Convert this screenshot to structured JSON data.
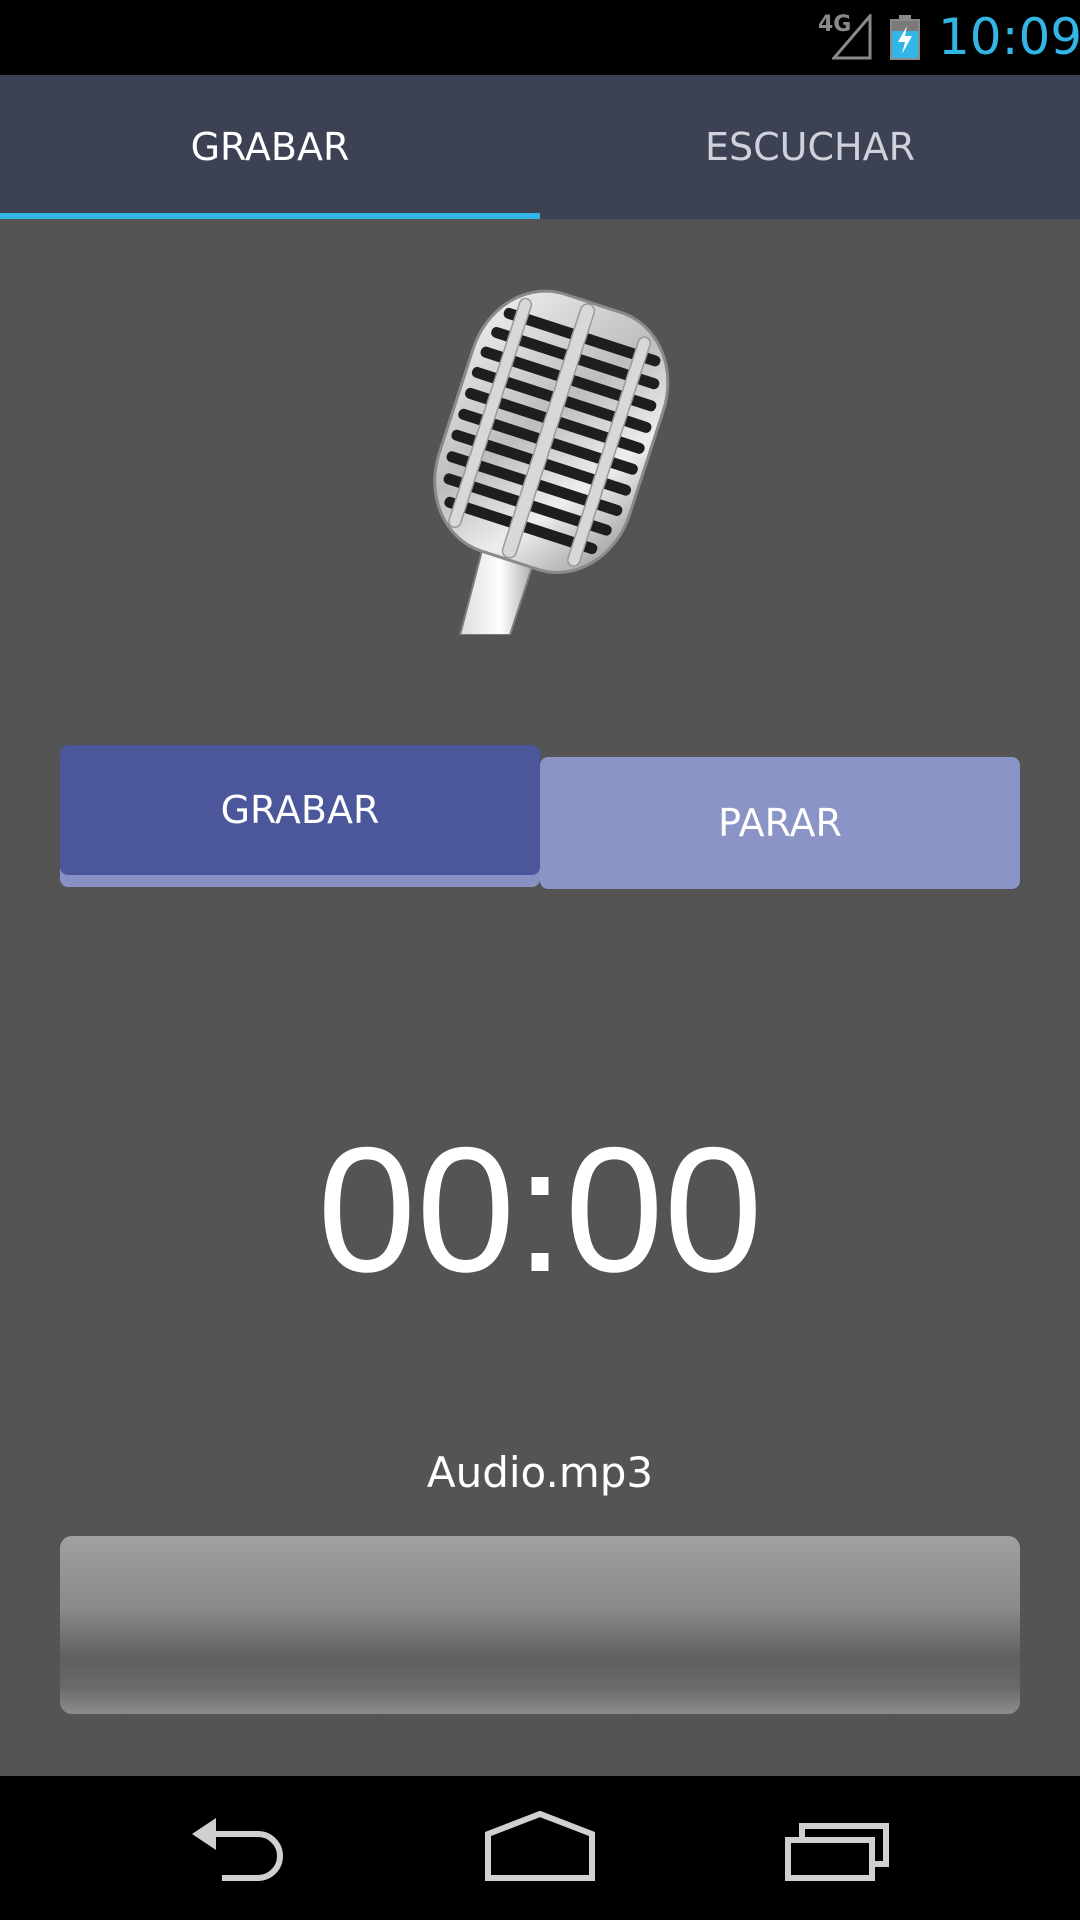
{
  "status_bar": {
    "network": "4G",
    "clock": "10:09",
    "clock_color": "#33b5e5",
    "signal_icon": "signal-icon",
    "battery_icon": "battery-charging-icon"
  },
  "tabs": [
    {
      "label": "GRABAR",
      "selected": true
    },
    {
      "label": "ESCUCHAR",
      "selected": false
    }
  ],
  "accent_color": "#33b5e5",
  "microphone_icon": "microphone-icon",
  "buttons": {
    "record_label": "GRABAR",
    "stop_label": "PARAR",
    "record_color": "#4b579a",
    "stop_color": "#8b94c6"
  },
  "timer": "00:00",
  "file_name": "Audio.mp3",
  "progress": 0,
  "nav": {
    "back_icon": "back-icon",
    "home_icon": "home-icon",
    "recents_icon": "recents-icon"
  }
}
